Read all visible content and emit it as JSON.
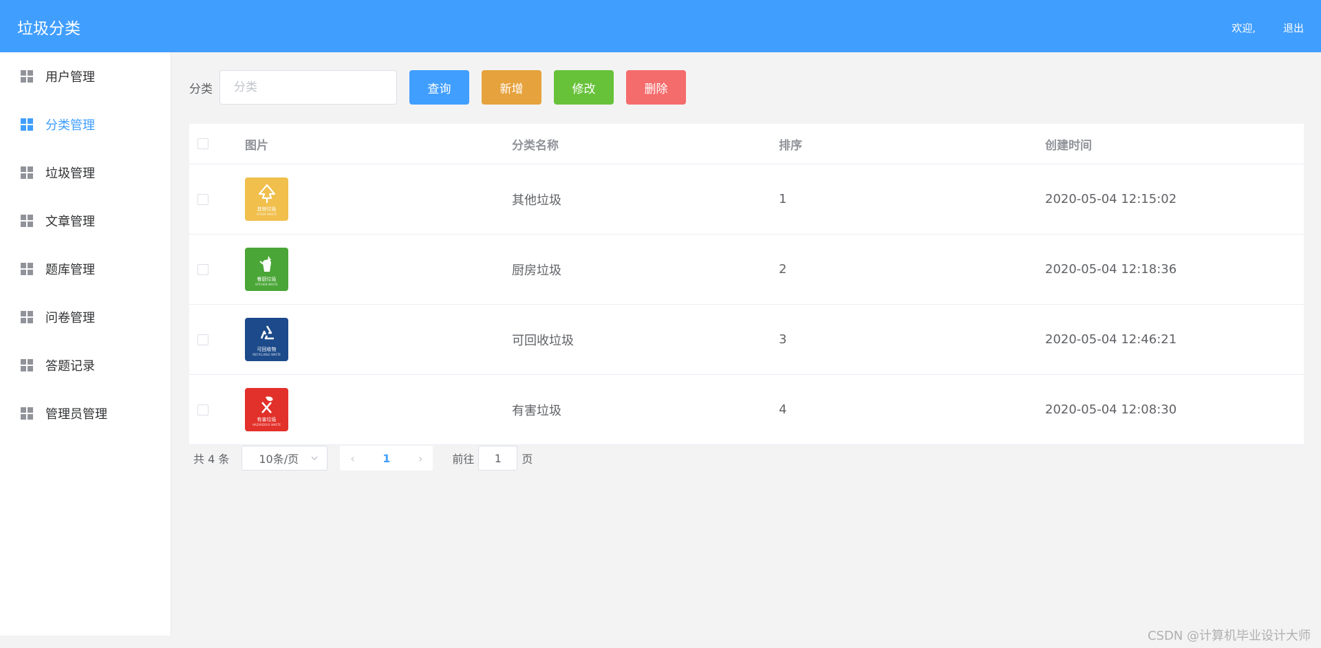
{
  "header": {
    "title": "垃圾分类",
    "welcome": "欢迎,",
    "logout": "退出"
  },
  "sidebar": {
    "items": [
      {
        "label": "用户管理"
      },
      {
        "label": "分类管理"
      },
      {
        "label": "垃圾管理"
      },
      {
        "label": "文章管理"
      },
      {
        "label": "题库管理"
      },
      {
        "label": "问卷管理"
      },
      {
        "label": "答题记录"
      },
      {
        "label": "管理员管理"
      }
    ],
    "active_index": 1
  },
  "toolbar": {
    "search_label": "分类",
    "search_placeholder": "分类",
    "search_value": "",
    "query": "查询",
    "add": "新增",
    "edit": "修改",
    "delete": "删除"
  },
  "table": {
    "headers": {
      "image": "图片",
      "name": "分类名称",
      "sort": "排序",
      "created": "创建时间"
    },
    "rows": [
      {
        "image_caption": "其他垃圾",
        "image_caption_en": "OTHER WASTE",
        "image_color": "#f0bf4c",
        "icon": "recycle-tree-icon",
        "name": "其他垃圾",
        "sort": "1",
        "created": "2020-05-04 12:15:02"
      },
      {
        "image_caption": "餐厨垃圾",
        "image_caption_en": "KITCHEN WASTE",
        "image_color": "#4aa637",
        "icon": "food-waste-icon",
        "name": "厨房垃圾",
        "sort": "2",
        "created": "2020-05-04 12:18:36"
      },
      {
        "image_caption": "可回收物",
        "image_caption_en": "RECYCLABLE WASTE",
        "image_color": "#1c4a8a",
        "icon": "recycle-icon",
        "name": "可回收垃圾",
        "sort": "3",
        "created": "2020-05-04 12:46:21"
      },
      {
        "image_caption": "有害垃圾",
        "image_caption_en": "HAZARDOUS WASTE",
        "image_color": "#e2302a",
        "icon": "hazardous-icon",
        "name": "有害垃圾",
        "sort": "4",
        "created": "2020-05-04 12:08:30"
      }
    ]
  },
  "pagination": {
    "total_text": "共 4 条",
    "page_size": "10条/页",
    "current_page": "1",
    "goto_prefix": "前往",
    "goto_value": "1",
    "goto_suffix": "页"
  },
  "watermark": "CSDN @计算机毕业设计大师",
  "colors": {
    "primary": "#409eff",
    "warning": "#e6a23c",
    "success": "#67c23a",
    "danger": "#f56c6c"
  }
}
